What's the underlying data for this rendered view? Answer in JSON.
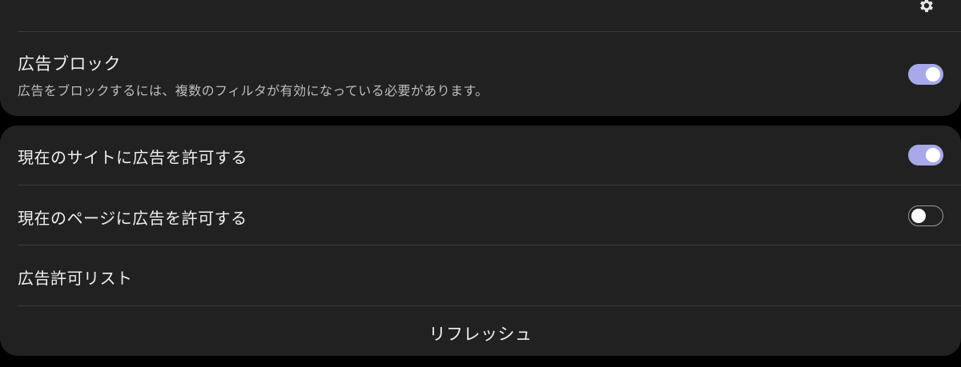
{
  "adblock": {
    "title": "広告ブロック",
    "description": "広告をブロックするには、複数のフィルタが有効になっている必要があります。",
    "enabled": true
  },
  "settings_icon": "gear-icon",
  "rows": [
    {
      "label": "現在のサイトに広告を許可する",
      "enabled": true
    },
    {
      "label": "現在のページに広告を許可する",
      "enabled": false
    },
    {
      "label": "広告許可リスト"
    }
  ],
  "refresh_label": "リフレッシュ",
  "colors": {
    "background": "#000000",
    "card": "#212121",
    "toggle_on": "#a9a8e8",
    "divider": "#3a3a3a"
  }
}
